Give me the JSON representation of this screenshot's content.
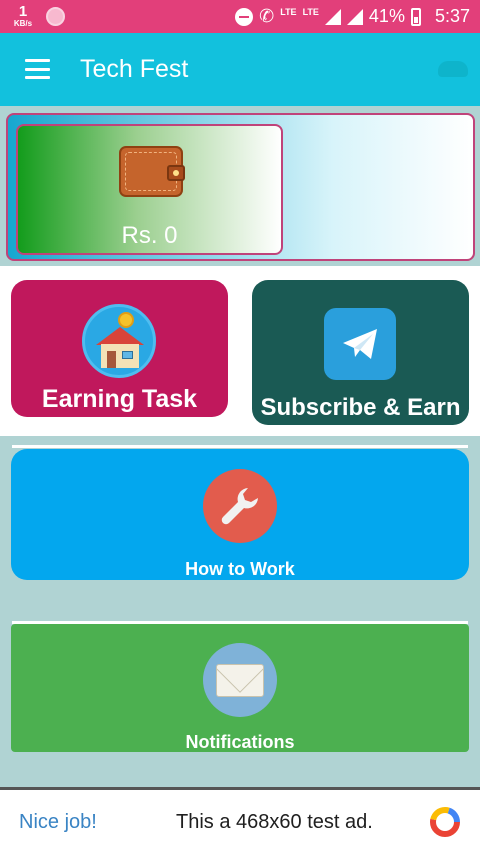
{
  "status_bar": {
    "net_speed_value": "1",
    "net_speed_unit": "KB/s",
    "network_label_1": "LTE",
    "network_label_2": "LTE",
    "battery": "41%",
    "time": "5:37"
  },
  "app_bar": {
    "title": "Tech Fest",
    "icons": [
      "menu-icon",
      "cloud-icon"
    ]
  },
  "wallet": {
    "amount": "Rs. 0",
    "icon": "wallet-icon"
  },
  "tiles": [
    {
      "label": "Earning Task",
      "icon": "house-icon",
      "color": "#c0185c"
    },
    {
      "label": "Subscribe & Earn",
      "icon": "telegram-icon",
      "color": "#1a5a54"
    }
  ],
  "cards": [
    {
      "label": "How to Work",
      "icon": "wrench-icon",
      "color": "#03a7ee"
    },
    {
      "label": "Notifications",
      "icon": "mail-icon",
      "color": "#4cb050"
    }
  ],
  "ad": {
    "nice": "Nice job!",
    "text": "This a 468x60 test ad.",
    "icon": "ad-choices-logo-icon"
  },
  "colors": {
    "status_bar": "#e23f7a",
    "app_bar": "#12c1dd",
    "background": "#b0d3d3"
  }
}
